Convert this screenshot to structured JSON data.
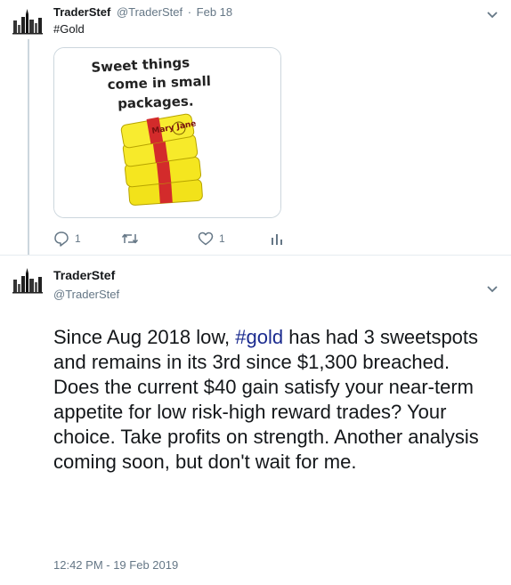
{
  "tweet1": {
    "name": "TraderStef",
    "handle": "@TraderStef",
    "separator": "·",
    "date": "Feb 18",
    "hashtag": "#Gold",
    "image": {
      "caption_line1": "Sweet things",
      "caption_line2": "come in small",
      "caption_line3": "packages.",
      "wrapper_brand": "Mary Jane"
    },
    "actions": {
      "reply_icon": "reply-icon",
      "reply_count": "1",
      "retweet_icon": "retweet-icon",
      "retweet_count": "",
      "like_icon": "heart-icon",
      "like_count": "1",
      "analytics_icon": "analytics-icon"
    }
  },
  "tweet2": {
    "name": "TraderStef",
    "handle": "@TraderStef",
    "text_before_hashtag": "Since Aug 2018 low, ",
    "hashtag": "#gold",
    "text_after_hashtag": " has had 3 sweetspots and remains in its 3rd since $1,300 breached.  Does the current $40 gain satisfy your near-term appetite for low risk-high reward trades?  Your choice.  Take profits on strength.  Another analysis coming soon, but don't wait for me.",
    "timestamp": "12:42 PM - 19 Feb 2019"
  },
  "colors": {
    "text": "#14171a",
    "secondary": "#657786",
    "hashtag": "#1b2b8f",
    "border": "#e6ecf0",
    "thread_line": "#ccd6dd"
  }
}
